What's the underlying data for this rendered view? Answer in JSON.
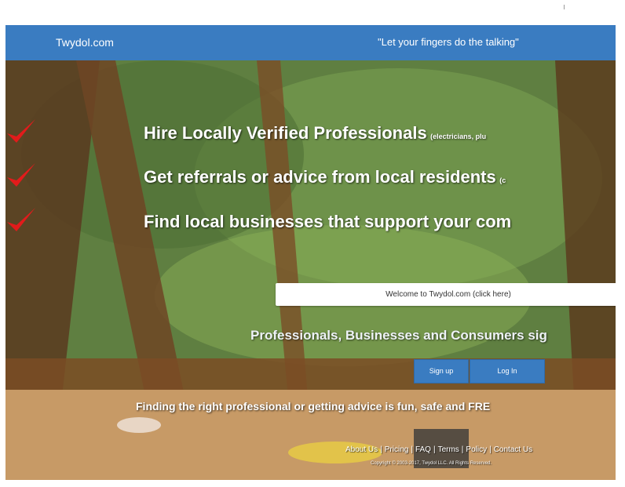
{
  "header": {
    "brand": "Twydol.com",
    "tagline": "\"Let your fingers do the talking\""
  },
  "features": [
    {
      "main": "Hire Locally Verified Professionals",
      "sub": "(electricians, plu"
    },
    {
      "main": "Get referrals or advice from local residents",
      "sub": "(c"
    },
    {
      "main": "Find local businesses that support your com",
      "sub": ""
    }
  ],
  "welcome_bar": "Welcome to Twydol.com (click here)",
  "signup_line": "Professionals, Businesses and Consumers sig",
  "buttons": {
    "signup": "Sign up",
    "login": "Log In"
  },
  "bottom_tagline": "Finding the right professional or getting advice is fun, safe and FRE",
  "footer": {
    "links": [
      "About Us",
      "Pricing",
      "FAQ",
      "Terms",
      "Policy",
      "Contact Us"
    ],
    "copyright": "Copyright © 2003-2017, Twydol LLC. All Rights Reserved."
  },
  "colors": {
    "header_bg": "#3a7cc1",
    "button_bg": "#3a7cc1",
    "checkmark": "#e21b1b"
  },
  "icons": {
    "check": "checkmark-icon"
  }
}
